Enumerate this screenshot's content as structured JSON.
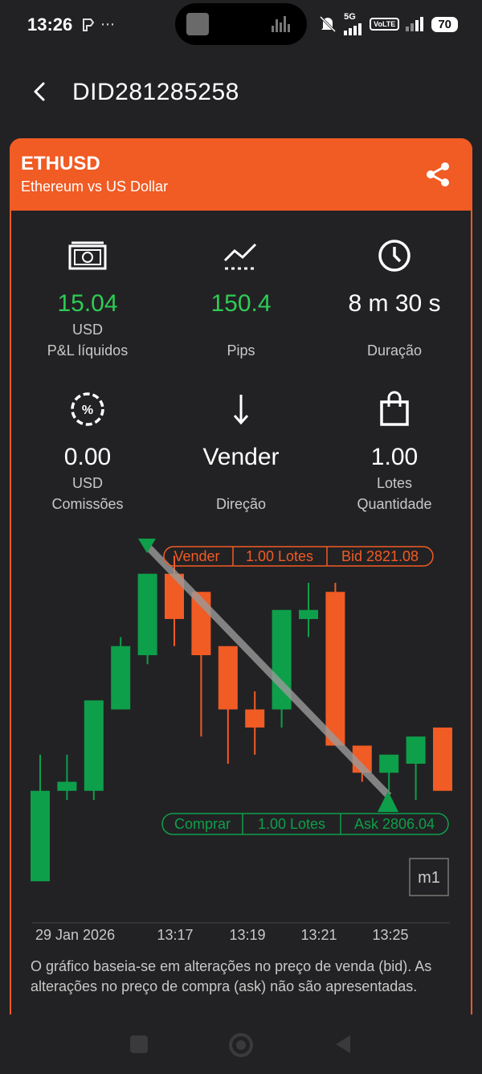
{
  "status_bar": {
    "time": "13:26",
    "left_icons": "⋯",
    "network_label": "5G",
    "volte_label": "VoLTE",
    "battery": "70"
  },
  "header": {
    "title": "DID281285258",
    "back_icon": "chevron-left-icon"
  },
  "card": {
    "symbol": "ETHUSD",
    "description": "Ethereum vs US Dollar",
    "share_icon": "share-icon",
    "accent_color": "#F15B24"
  },
  "stats": {
    "pnl": {
      "value": "15.04",
      "unit": "USD",
      "label": "P&L líquidos",
      "icon": "money-icon"
    },
    "pips": {
      "value": "150.4",
      "label": "Pips",
      "icon": "trend-icon"
    },
    "duration": {
      "value": "8 m 30 s",
      "label": "Duração",
      "icon": "clock-icon"
    },
    "commission": {
      "value": "0.00",
      "unit": "USD",
      "label": "Comissões",
      "icon": "percent-icon"
    },
    "direction": {
      "value": "Vender",
      "label": "Direção",
      "icon": "arrow-down-icon"
    },
    "quantity": {
      "value": "1.00",
      "unit": "Lotes",
      "label": "Quantidade",
      "icon": "bag-icon"
    }
  },
  "chart": {
    "sell_tag": {
      "side": "Vender",
      "lots": "1.00 Lotes",
      "price": "Bid 2821.08"
    },
    "buy_tag": {
      "side": "Comprar",
      "lots": "1.00 Lotes",
      "price": "Ask 2806.04"
    },
    "timeframe": "m1",
    "x_labels": [
      "29 Jan 2026",
      "13:17",
      "13:19",
      "13:21",
      "13:25"
    ],
    "up_color": "#0E9F4A",
    "down_color": "#F15B24",
    "candles": [
      {
        "o": 2799,
        "h": 2813,
        "l": 2799,
        "c": 2809
      },
      {
        "o": 2809,
        "h": 2813,
        "l": 2808,
        "c": 2810
      },
      {
        "o": 2809,
        "h": 2818,
        "l": 2808,
        "c": 2819
      },
      {
        "o": 2818,
        "h": 2826,
        "l": 2818,
        "c": 2825
      },
      {
        "o": 2824,
        "h": 2833,
        "l": 2823,
        "c": 2833
      },
      {
        "o": 2833,
        "h": 2835,
        "l": 2825,
        "c": 2828
      },
      {
        "o": 2831,
        "h": 2831,
        "l": 2815,
        "c": 2824
      },
      {
        "o": 2825,
        "h": 2825,
        "l": 2812,
        "c": 2818
      },
      {
        "o": 2818,
        "h": 2820,
        "l": 2813,
        "c": 2816
      },
      {
        "o": 2818,
        "h": 2829,
        "l": 2816,
        "c": 2829
      },
      {
        "o": 2828,
        "h": 2832,
        "l": 2826,
        "c": 2829
      },
      {
        "o": 2831,
        "h": 2832,
        "l": 2815,
        "c": 2814
      },
      {
        "o": 2814,
        "h": 2814,
        "l": 2810,
        "c": 2811
      },
      {
        "o": 2811,
        "h": 2813,
        "l": 2809,
        "c": 2813
      },
      {
        "o": 2812,
        "h": 2814,
        "l": 2808,
        "c": 2815
      },
      {
        "o": 2816,
        "h": 2815,
        "l": 2809,
        "c": 2809
      }
    ],
    "sell_price": 2821.08,
    "buy_price": 2806.04
  },
  "note": "O gráfico baseia-se em alterações no preço de venda (bid). As alterações no preço de compra (ask) não são apresentadas."
}
